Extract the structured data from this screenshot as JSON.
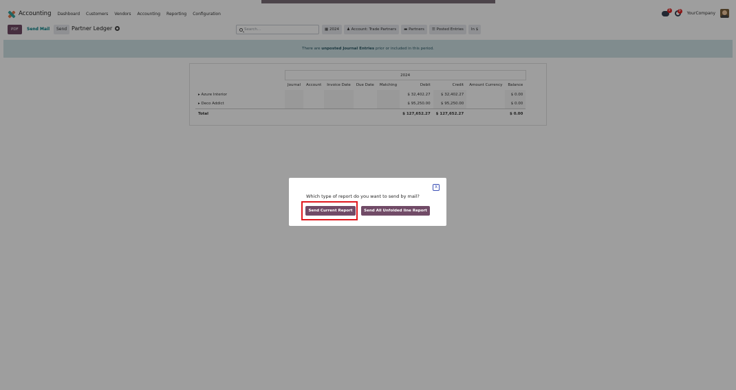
{
  "nav": {
    "app_name": "Accounting",
    "menu": [
      "Dashboard",
      "Customers",
      "Vendors",
      "Accounting",
      "Reporting",
      "Configuration"
    ],
    "company": "YourCompany",
    "chat_badge": "9",
    "activity_badge": "9"
  },
  "control": {
    "pdf_label": "PDF",
    "send_mail_label": "Send Mail",
    "send_label": "Send",
    "report_title": "Partner Ledger",
    "search_placeholder": "Search...",
    "filters": [
      "2024",
      "Account: Trade Partners",
      "Partners",
      "Posted Entries",
      "In $"
    ]
  },
  "banner": {
    "prefix": "There are",
    "bold": "unposted Journal Entries",
    "suffix": "prior or included in this period."
  },
  "report": {
    "year": "2024",
    "columns": [
      "Journal",
      "Account",
      "Invoice Date",
      "Due Date",
      "Matching",
      "Debit",
      "Credit",
      "Amount Currency",
      "Balance"
    ],
    "rows": [
      {
        "name": "Azure Interior",
        "debit": "$ 32,402.27",
        "credit": "$ 32,402.27",
        "balance": "$ 0.00"
      },
      {
        "name": "Deco Addict",
        "debit": "$ 95,250.00",
        "credit": "$ 95,250.00",
        "balance": "$ 0.00"
      }
    ],
    "total": {
      "name": "Total",
      "debit": "$ 127,652.27",
      "credit": "$ 127,652.27",
      "balance": "$ 0.00"
    }
  },
  "modal": {
    "close_label": "X",
    "question": "Which type of report do you want to send by mail?",
    "send_current_label": "Send Current Report",
    "send_all_label": "Send All Unfolded line Report"
  },
  "colors": {
    "brand": "#714b67",
    "teal": "#017e84",
    "banner_bg": "#cfe2e6",
    "highlight": "#e0161c"
  }
}
